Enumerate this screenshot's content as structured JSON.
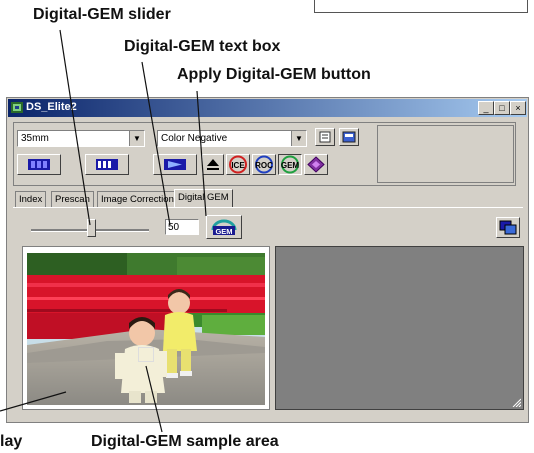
{
  "callouts": {
    "slider": "Digital-GEM slider",
    "text_box": "Digital-GEM text box",
    "apply_button": "Apply Digital-GEM button",
    "display": "lay",
    "sample_area": "Digital-GEM sample area"
  },
  "window": {
    "title": "DS_Elite2",
    "minimize": "_",
    "maximize": "□",
    "close": "×"
  },
  "toolbar": {
    "film_format": "35mm",
    "film_type": "Color Negative",
    "icons": [
      "prescan-icon",
      "index-scan-icon",
      "scan-icon",
      "eject-icon",
      "ice-icon",
      "roc-icon",
      "gem-icon",
      "pointer-icon"
    ],
    "ice_label": "ICE",
    "roc_label": "ROC",
    "gem_label": "GEM"
  },
  "tabs": [
    "Index",
    "Prescan",
    "Image Correction",
    "Digital GEM"
  ],
  "active_tab": "Digital GEM",
  "gem": {
    "value": "50",
    "slider_level_fraction": 0.5
  },
  "colors": {
    "title_start": "#0a246a",
    "title_end": "#a6caf0",
    "window_bg": "#d4d0c8",
    "grey_area": "#808080"
  }
}
